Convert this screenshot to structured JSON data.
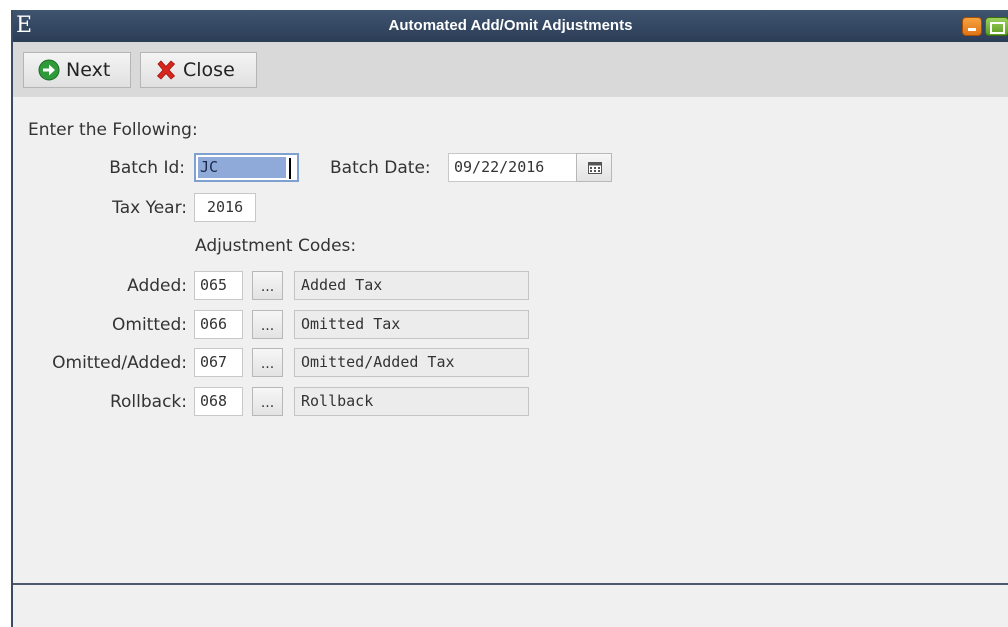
{
  "window": {
    "app_icon_letter": "E",
    "title": "Automated Add/Omit Adjustments"
  },
  "toolbar": {
    "next_label": "Next",
    "close_label": "Close"
  },
  "form": {
    "heading": "Enter the Following:",
    "batch_id_label": "Batch Id:",
    "batch_id_value": "JC",
    "batch_date_label": "Batch Date:",
    "batch_date_value": "09/22/2016",
    "tax_year_label": "Tax Year:",
    "tax_year_value": "2016",
    "adjustment_codes_heading": "Adjustment Codes:",
    "lookup_label": "...",
    "codes": [
      {
        "label": "Added:",
        "code": "065",
        "description": "Added Tax"
      },
      {
        "label": "Omitted:",
        "code": "066",
        "description": "Omitted Tax"
      },
      {
        "label": "Omitted/Added:",
        "code": "067",
        "description": "Omitted/Added Tax"
      },
      {
        "label": "Rollback:",
        "code": "068",
        "description": "Rollback"
      }
    ]
  },
  "colors": {
    "titlebar": "#344863",
    "next_icon": "#2e9a3a",
    "close_icon": "#d8261c",
    "selection": "#8faad8"
  }
}
